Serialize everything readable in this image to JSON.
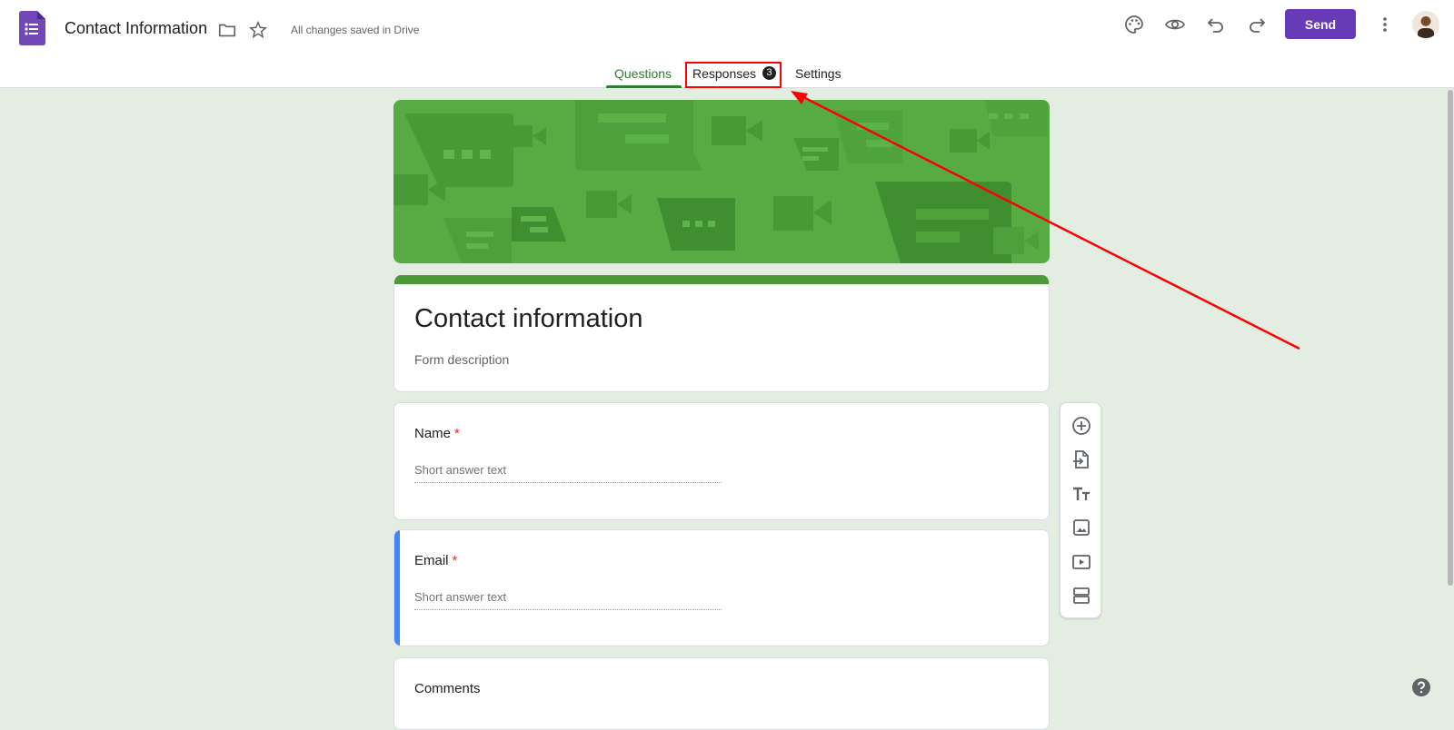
{
  "header": {
    "title": "Contact Information",
    "save_status": "All changes saved in Drive",
    "send_label": "Send"
  },
  "tabs": [
    {
      "label": "Questions",
      "active": true
    },
    {
      "label": "Responses",
      "badge": "3"
    },
    {
      "label": "Settings"
    }
  ],
  "form": {
    "title": "Contact information",
    "description": "Form description",
    "questions": [
      {
        "label": "Name",
        "required_mark": "*",
        "placeholder": "Short answer text"
      },
      {
        "label": "Email",
        "required_mark": "*",
        "placeholder": "Short answer text"
      },
      {
        "label": "Comments"
      }
    ]
  },
  "icons": {
    "app": "google-forms-icon",
    "folder": "folder-icon",
    "star": "star-icon",
    "palette": "palette-icon",
    "preview": "eye-icon",
    "undo": "undo-icon",
    "redo": "redo-icon",
    "more": "more-vert-icon",
    "add_question": "add-circle-icon",
    "import_questions": "import-icon",
    "add_title": "title-text-icon",
    "add_image": "image-icon",
    "add_video": "video-icon",
    "add_section": "section-icon",
    "help": "help-icon"
  },
  "colors": {
    "accent": "#673ab7",
    "theme_green": "#4a9a3a",
    "background": "#e3ede1",
    "active_blue": "#4285f4",
    "annotation_red": "#ff0000"
  }
}
